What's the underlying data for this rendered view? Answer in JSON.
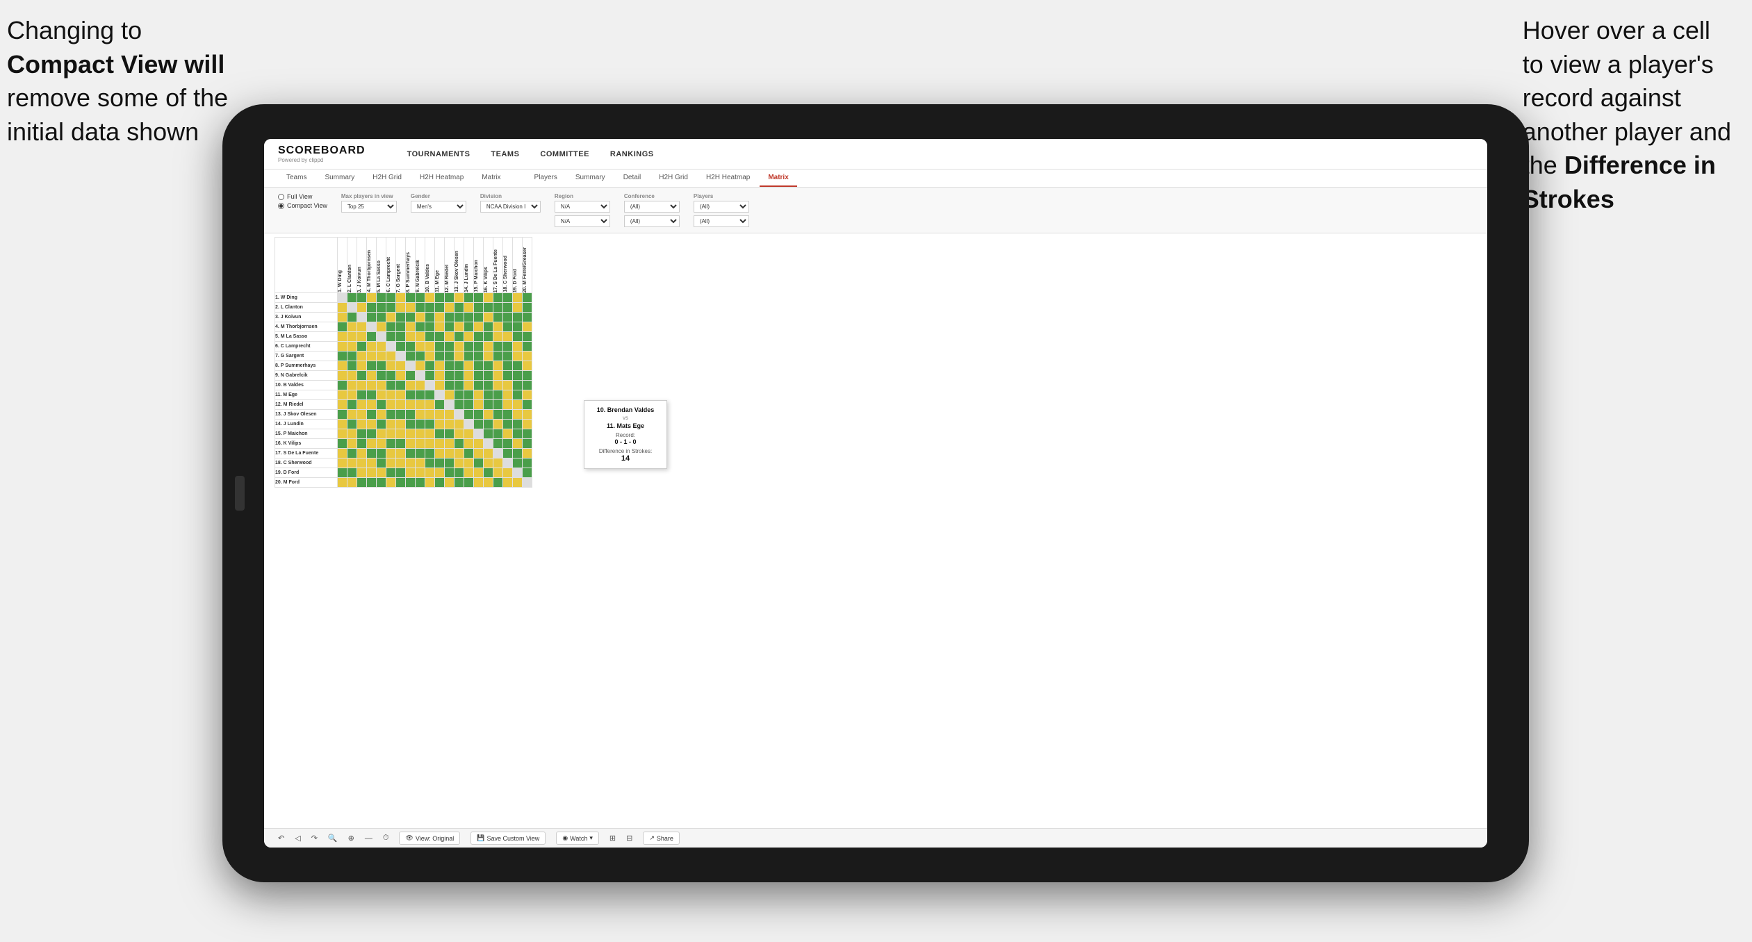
{
  "annotations": {
    "left": {
      "line1": "Changing to",
      "bold": "Compact View",
      "line2": " will",
      "line3": "remove some of the",
      "line4": "initial data shown"
    },
    "right": {
      "line1": "Hover over a cell",
      "line2": "to view a player's",
      "line3": "record against",
      "line4": "another player and",
      "line5": "the ",
      "bold": "Difference in",
      "bold2": "Strokes"
    }
  },
  "nav": {
    "logo": "SCOREBOARD",
    "logo_sub": "Powered by clippd",
    "links": [
      "TOURNAMENTS",
      "TEAMS",
      "COMMITTEE",
      "RANKINGS"
    ]
  },
  "sub_tabs": {
    "group1": [
      "Teams",
      "Summary",
      "H2H Grid",
      "H2H Heatmap",
      "Matrix"
    ],
    "group2": [
      "Players",
      "Summary",
      "Detail",
      "H2H Grid",
      "H2H Heatmap",
      "Matrix"
    ],
    "active": "Matrix"
  },
  "filters": {
    "view_options": [
      "Full View",
      "Compact View"
    ],
    "selected_view": "Compact View",
    "max_players_label": "Max players in view",
    "max_players_value": "Top 25",
    "gender_label": "Gender",
    "gender_value": "Men's",
    "division_label": "Division",
    "division_value": "NCAA Division I",
    "region_label": "Region",
    "region_value": "N/A",
    "conference_label": "Conference",
    "conference_value": "(All)",
    "players_label": "Players",
    "players_value": "(All)"
  },
  "column_headers": [
    "1. W Ding",
    "2. L Clanton",
    "3. J Koivun",
    "4. M Thorbjornsen",
    "5. M La Sasso",
    "6. C Lamprecht",
    "7. G Sargent",
    "8. P Summerhays",
    "9. N Gabrelcik",
    "10. B Valdes",
    "11. M Ege",
    "12. M Riedel",
    "13. J Skov Olesen",
    "14. J Lundin",
    "15. P Maichon",
    "16. K Vilips",
    "17. S De La Fuente",
    "18. C Sherwood",
    "19. D Ford",
    "20. M Ferre"
  ],
  "row_players": [
    "1. W Ding",
    "2. L Clanton",
    "3. J Koivun",
    "4. M Thorbjornsen",
    "5. M La Sasso",
    "6. C Lamprecht",
    "7. G Sargent",
    "8. P Summerhays",
    "9. N Gabrelcik",
    "10. B Valdes",
    "11. M Ege",
    "12. M Riedel",
    "13. J Skov Olesen",
    "14. J Lundin",
    "15. P Maichon",
    "16. K Vilips",
    "17. S De La Fuente",
    "18. C Sherwood",
    "19. D Ford",
    "20. M Ford"
  ],
  "tooltip": {
    "player1": "10. Brendan Valdes",
    "vs": "vs",
    "player2": "11. Mats Ege",
    "record_label": "Record:",
    "record": "0 - 1 - 0",
    "diff_label": "Difference in Strokes:",
    "diff": "14"
  },
  "toolbar": {
    "view_original": "View: Original",
    "save_custom": "Save Custom View",
    "watch": "Watch",
    "share": "Share"
  }
}
